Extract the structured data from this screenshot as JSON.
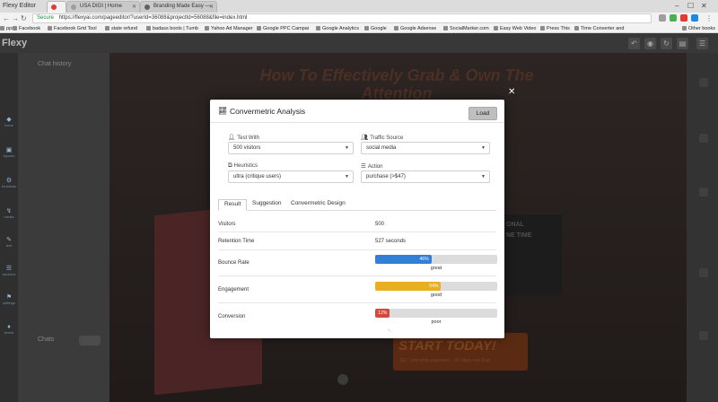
{
  "window": {
    "title": "Flexy Editor"
  },
  "tabs": [
    {
      "label": "X",
      "active": true,
      "color": "#e53935"
    },
    {
      "label": "USA DIGI | Home",
      "active": false,
      "color": "#777777"
    },
    {
      "label": "Branding Made Easy —",
      "active": false,
      "color": "#555555"
    }
  ],
  "address": {
    "security": "Secure",
    "url": "https://flexyai.com/pageeditor/?userId=36088&projectId=56088&file=index.html"
  },
  "bookmarks": [
    "pps",
    "Facebook",
    "Facebook Grid Tool",
    "state refund",
    "badass boots | Tumb",
    "Yahoo Ad Manager",
    "Google PPC Campai",
    "Google Analytics",
    "Google",
    "Google Adsense",
    "SocialMarker.com",
    "Easy Web Video",
    "Press This",
    "Time Converter and",
    "Other books"
  ],
  "app": {
    "logo": "Flexy",
    "left_panel_title": "Chat history",
    "chats_label": "Chats",
    "left_items": [
      {
        "icon": "◆",
        "label": "home"
      },
      {
        "icon": "▣",
        "label": "layouts"
      },
      {
        "icon": "⚙",
        "label": "functions"
      },
      {
        "icon": "↯",
        "label": "media"
      },
      {
        "icon": "✎",
        "label": "text"
      },
      {
        "icon": "☰",
        "label": "sections"
      },
      {
        "icon": "⚑",
        "label": "settings"
      },
      {
        "icon": "♦",
        "label": "brand"
      }
    ]
  },
  "background_page": {
    "headline": "How To Effectively Grab & Own The Attention",
    "side_text": "ONAL\nNE TIME",
    "cta": "START TODAY!",
    "cta_sub": "$17 one-time payment - 30 days risk free"
  },
  "modal": {
    "title": "Convermetric Analysis",
    "load_label": "Load",
    "fields": {
      "test_with": {
        "label": "Test With",
        "value": "500 visitors"
      },
      "traffic_source": {
        "label": "Traffic Source",
        "value": "social media"
      },
      "heuristics": {
        "label": "Heuristics",
        "value": "ultra (critique users)"
      },
      "action": {
        "label": "Action",
        "value": "purchase (>$47)"
      }
    },
    "tabs": [
      {
        "label": "Result",
        "active": true
      },
      {
        "label": "Suggestion",
        "active": false
      },
      {
        "label": "Convermetric Design",
        "active": false
      }
    ],
    "results": {
      "visitors": {
        "label": "Visitors",
        "value": "500"
      },
      "retention": {
        "label": "Retention Time",
        "value": "527 seconds"
      },
      "bounce": {
        "label": "Bounce Rate",
        "percent": 46,
        "percent_label": "46%",
        "rating": "great",
        "color": "#2f80d6"
      },
      "engagement": {
        "label": "Engagement",
        "percent": 54,
        "percent_label": "54%",
        "rating": "good",
        "color": "#e8b021"
      },
      "conversion": {
        "label": "Conversion",
        "percent": 12,
        "percent_label": "12%",
        "rating": "poor",
        "color": "#d24a3c"
      }
    }
  }
}
